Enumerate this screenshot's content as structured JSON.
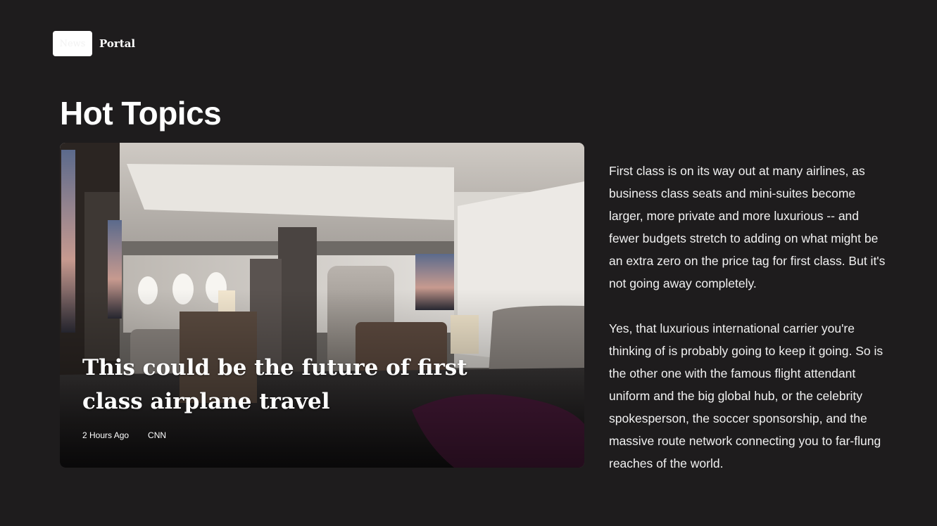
{
  "header": {
    "logo_box_text": "News",
    "logo_text": "Portal"
  },
  "section": {
    "title": "Hot Topics"
  },
  "featured": {
    "title": "This could be the future of first class airplane travel",
    "time": "2 Hours Ago",
    "source": "CNN",
    "image": "airplane-first-class-cabin"
  },
  "article": {
    "paragraphs": [
      "First class is on its way out at many airlines, as business class seats and mini-suites become larger, more private and more luxurious -- and fewer budgets stretch to adding on what might be an extra zero on the price tag for first class. But it's not going away completely.",
      "Yes, that luxurious international carrier you're thinking of is probably going to keep it going. So is the other one with the famous flight attendant uniform and the big global hub, or the celebrity spokesperson, the soccer sponsorship, and the massive route network connecting you to far-flung reaches of the world."
    ]
  },
  "colors": {
    "background": "#1e1c1d",
    "text": "#ffffff",
    "accent_purple": "#4e1c3e"
  }
}
